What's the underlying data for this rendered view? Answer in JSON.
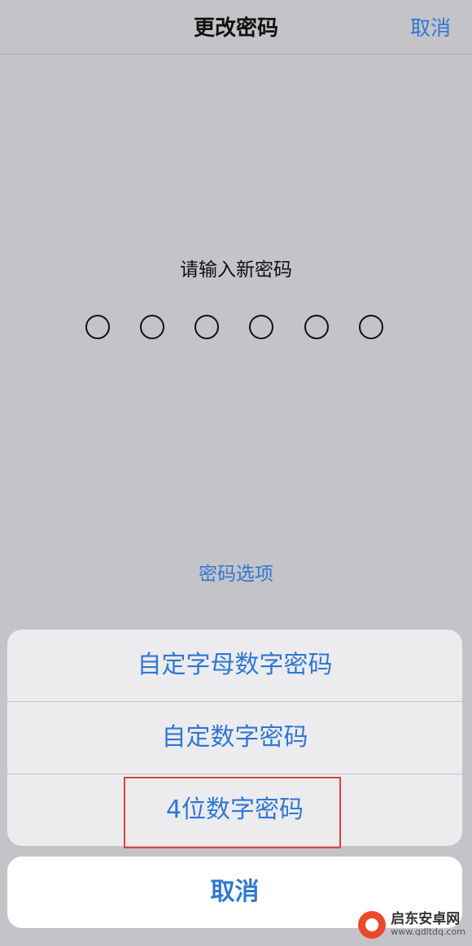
{
  "nav": {
    "title": "更改密码",
    "cancel": "取消"
  },
  "passcode": {
    "prompt": "请输入新密码",
    "digits": 6,
    "options_link": "密码选项"
  },
  "action_sheet": {
    "items": [
      {
        "label": "自定字母数字密码"
      },
      {
        "label": "自定数字密码"
      },
      {
        "label": "4位数字密码"
      }
    ],
    "highlighted_item": "4位数字密码",
    "cancel": "取消"
  },
  "watermark": {
    "name": "启东安卓网",
    "url": "www.qdltdq.com"
  },
  "colors": {
    "accent": "#2f78d2",
    "highlight": "#e0403a",
    "background": "#c3c3c8"
  },
  "icons": [
    "watermark-logo-icon"
  ]
}
